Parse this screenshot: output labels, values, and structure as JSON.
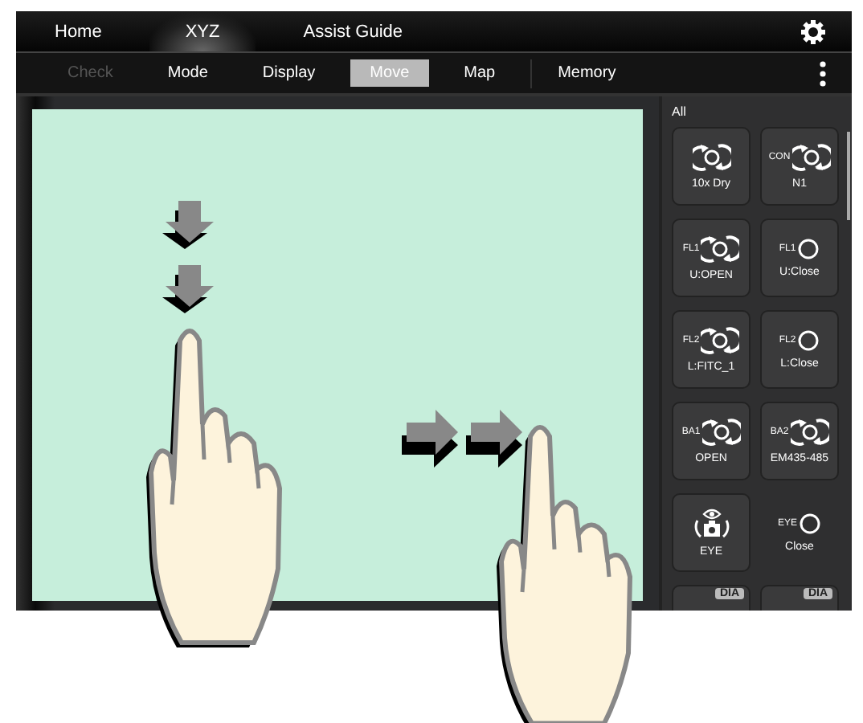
{
  "top_tabs": [
    {
      "label": "Home",
      "selected": false
    },
    {
      "label": "XYZ",
      "selected": true
    },
    {
      "label": "Assist Guide",
      "selected": false
    }
  ],
  "sub_tabs": [
    {
      "label": "Check",
      "selected": false,
      "disabled": true
    },
    {
      "label": "Mode",
      "selected": false,
      "disabled": false
    },
    {
      "label": "Display",
      "selected": false,
      "disabled": false
    },
    {
      "label": "Move",
      "selected": true,
      "disabled": false
    },
    {
      "label": "Map",
      "selected": false,
      "disabled": false
    },
    {
      "label": "Memory",
      "selected": false,
      "disabled": false
    }
  ],
  "panel": {
    "title": "All",
    "tiles": [
      {
        "kind": "rotate",
        "caption": "10x Dry",
        "framed": true
      },
      {
        "kind": "rotate",
        "prefix": "CON",
        "caption": "N1",
        "framed": true
      },
      {
        "kind": "rotate",
        "prefix": "FL1",
        "caption": "U:OPEN",
        "framed": true
      },
      {
        "kind": "ring",
        "prefix": "FL1",
        "caption": "U:Close",
        "framed": true
      },
      {
        "kind": "rotate",
        "prefix": "FL2",
        "caption": "L:FITC_1",
        "framed": true
      },
      {
        "kind": "ring",
        "prefix": "FL2",
        "caption": "L:Close",
        "framed": true
      },
      {
        "kind": "rotate",
        "prefix": "BA1",
        "caption": "OPEN",
        "framed": true
      },
      {
        "kind": "rotate",
        "prefix": "BA2",
        "caption": "EM435-485",
        "framed": true
      },
      {
        "kind": "camera",
        "caption": "EYE",
        "framed": true
      },
      {
        "kind": "ring",
        "prefix": "EYE",
        "caption": "Close",
        "framed": false
      },
      {
        "kind": "badge",
        "badge": "DIA",
        "framed": true
      },
      {
        "kind": "badge",
        "badge": "DIA",
        "framed": true
      }
    ]
  }
}
